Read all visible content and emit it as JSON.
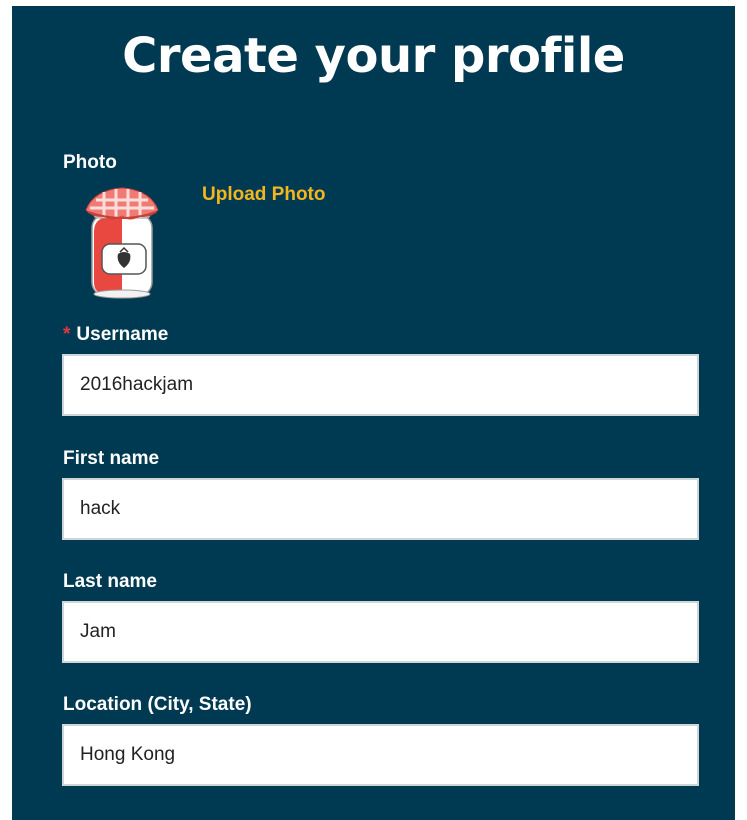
{
  "header": {
    "title": "Create your profile"
  },
  "photo": {
    "label": "Photo",
    "upload_label": "Upload Photo",
    "avatar_icon": "jam-jar-icon"
  },
  "fields": {
    "username": {
      "required_marker": "*",
      "label": "Username",
      "value": "2016hackjam"
    },
    "first_name": {
      "label": "First name",
      "value": "hack"
    },
    "last_name": {
      "label": "Last name",
      "value": "Jam"
    },
    "location": {
      "label": "Location (City, State)",
      "value": "Hong Kong"
    }
  },
  "colors": {
    "panel_background": "#003a52",
    "accent": "#f3b61f",
    "required": "#e03a3a",
    "text": "#ffffff"
  }
}
